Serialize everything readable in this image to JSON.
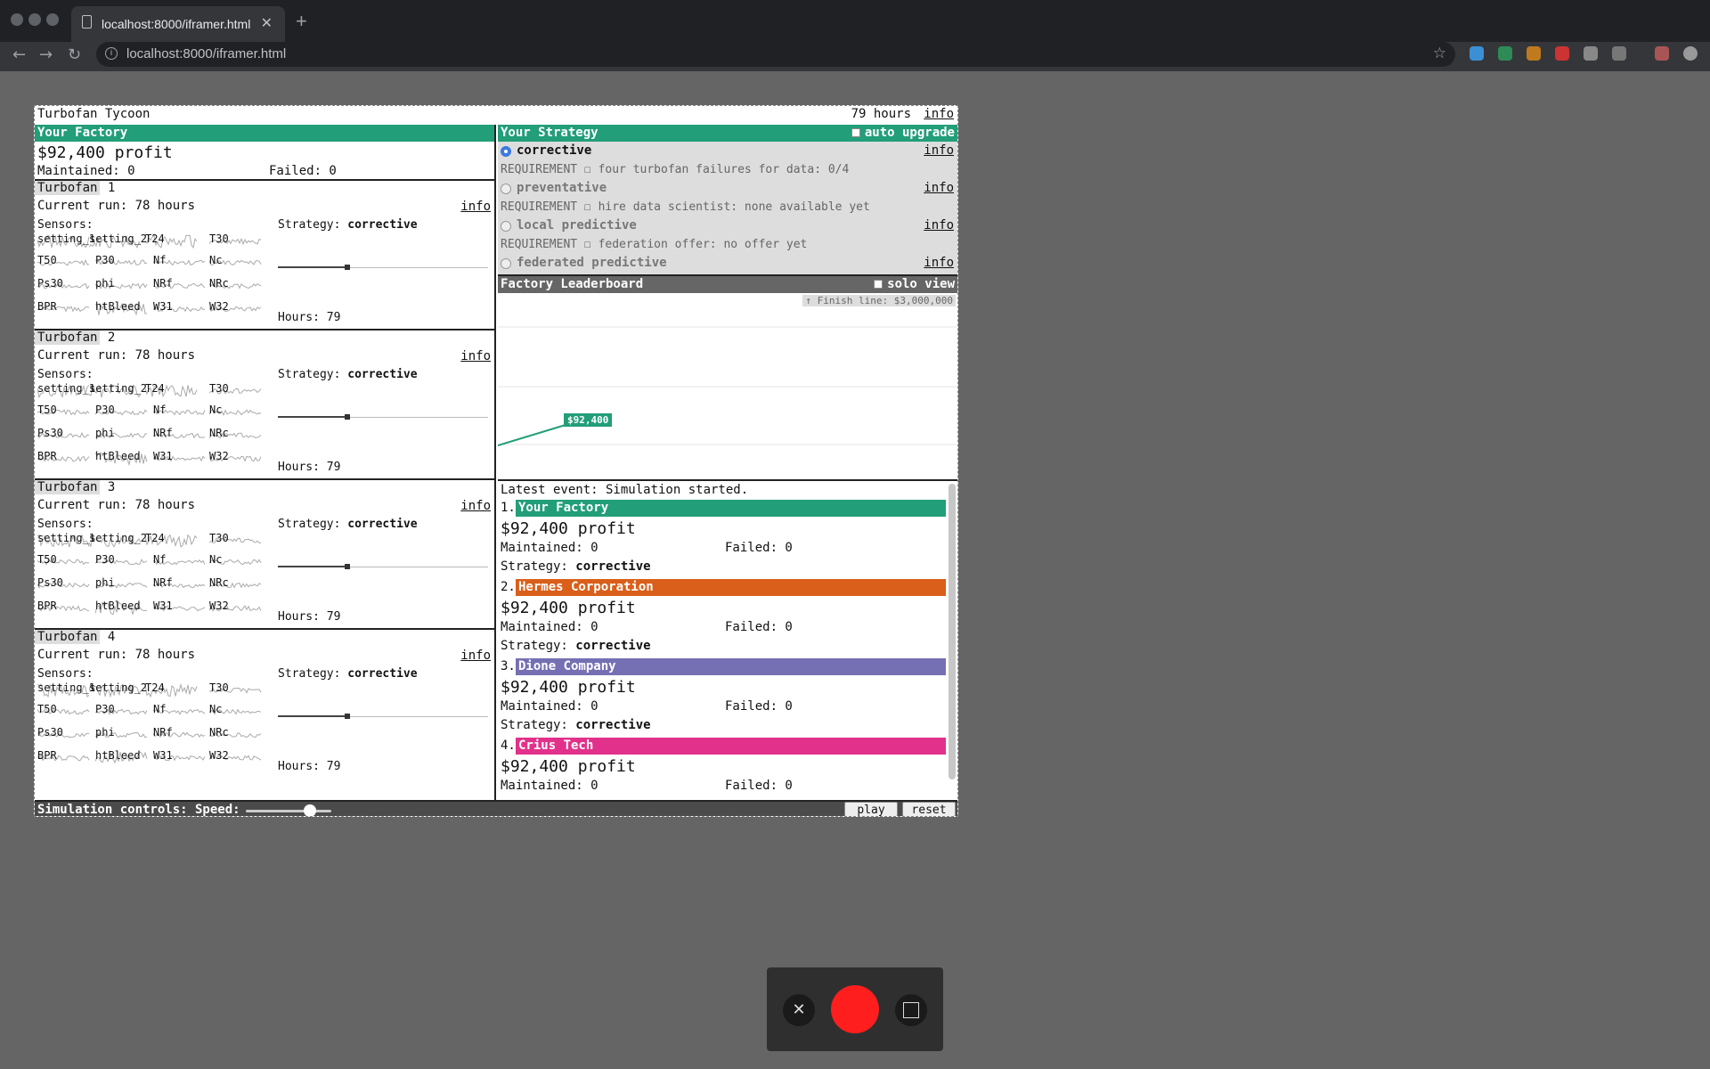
{
  "browser": {
    "tab_title": "localhost:8000/iframer.html",
    "tab_close": "✕",
    "new_tab": "+",
    "url": "localhost:8000/iframer.html",
    "nav": {
      "back": "←",
      "forward": "→",
      "reload": "↻"
    },
    "star": "☆",
    "info_icon": "i"
  },
  "app": {
    "title": "Turbofan Tycoon",
    "hours": "79 hours",
    "info": "info"
  },
  "factory": {
    "header": "Your Factory",
    "profit": "$92,400 profit",
    "maintained": "Maintained: 0",
    "failed": "Failed: 0",
    "turbofans": [
      {
        "label": "Turbofan",
        "num": "1",
        "run": "Current run: 78 hours",
        "info": "info",
        "sensors_label": "Sensors:",
        "strategy_label": "Strategy:",
        "strategy": "corrective",
        "hours": "Hours: 79"
      },
      {
        "label": "Turbofan",
        "num": "2",
        "run": "Current run: 78 hours",
        "info": "info",
        "sensors_label": "Sensors:",
        "strategy_label": "Strategy:",
        "strategy": "corrective",
        "hours": "Hours: 79"
      },
      {
        "label": "Turbofan",
        "num": "3",
        "run": "Current run: 78 hours",
        "info": "info",
        "sensors_label": "Sensors:",
        "strategy_label": "Strategy:",
        "strategy": "corrective",
        "hours": "Hours: 79"
      },
      {
        "label": "Turbofan",
        "num": "4",
        "run": "Current run: 78 hours",
        "info": "info",
        "sensors_label": "Sensors:",
        "strategy_label": "Strategy:",
        "strategy": "corrective",
        "hours": "Hours: 79"
      }
    ],
    "sensor_names": [
      "setting_1",
      "setting_2",
      "T24",
      "T30",
      "T50",
      "P30",
      "Nf",
      "Nc",
      "Ps30",
      "phi",
      "NRf",
      "NRc",
      "BPR",
      "htBleed",
      "W31",
      "W32"
    ]
  },
  "strategy": {
    "header": "Your Strategy",
    "auto_upgrade": "auto upgrade",
    "options": [
      {
        "name": "corrective",
        "info": "info",
        "selected": true
      },
      {
        "name": "preventative",
        "info": "info",
        "selected": false
      },
      {
        "name": "local predictive",
        "info": "info",
        "selected": false
      },
      {
        "name": "federated predictive",
        "info": "info",
        "selected": false
      }
    ],
    "requirements": [
      "REQUIREMENT ☐ four turbofan failures for data: 0/4",
      "REQUIREMENT ☐ hire data scientist: none available yet",
      "REQUIREMENT ☐ federation offer: no offer yet"
    ]
  },
  "leaderboard": {
    "header": "Factory Leaderboard",
    "solo_view": "solo view",
    "finish_line": "↑ Finish line: $3,000,000",
    "current_label": "$92,400",
    "line_color": "#229e79"
  },
  "events": {
    "latest": "Latest event: Simulation started.",
    "ranks": [
      {
        "num": "1.",
        "name": "Your Factory",
        "color": "#229e79",
        "profit": "$92,400 profit",
        "maintained": "Maintained: 0",
        "failed": "Failed: 0",
        "strategy_label": "Strategy:",
        "strategy": "corrective"
      },
      {
        "num": "2.",
        "name": "Hermes Corporation",
        "color": "#d95f1a",
        "profit": "$92,400 profit",
        "maintained": "Maintained: 0",
        "failed": "Failed: 0",
        "strategy_label": "Strategy:",
        "strategy": "corrective"
      },
      {
        "num": "3.",
        "name": "Dione Company",
        "color": "#7570b3",
        "profit": "$92,400 profit",
        "maintained": "Maintained: 0",
        "failed": "Failed: 0",
        "strategy_label": "Strategy:",
        "strategy": "corrective"
      },
      {
        "num": "4.",
        "name": "Crius Tech",
        "color": "#e2318a",
        "profit": "$92,400 profit",
        "maintained": "Maintained: 0",
        "failed": "Failed: 0",
        "strategy_label": "",
        "strategy": ""
      }
    ]
  },
  "controls": {
    "label": "Simulation controls: Speed:",
    "speed": 0.75,
    "play": "play",
    "reset": "reset"
  },
  "recorder": {
    "close": "✕"
  }
}
